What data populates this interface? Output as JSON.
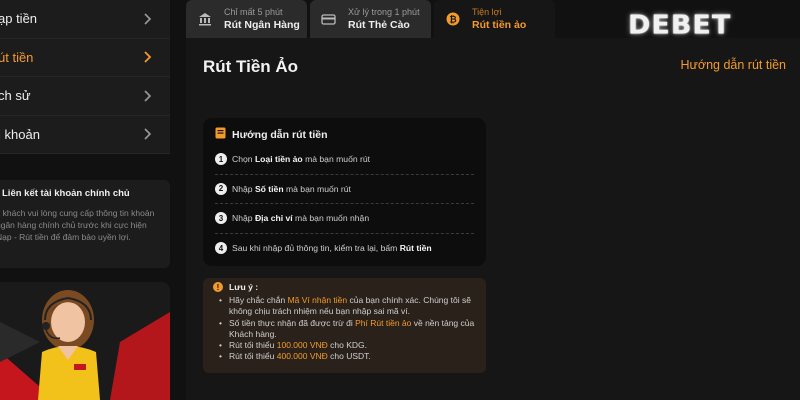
{
  "sidebar": {
    "items": [
      {
        "label": "ạp tiền",
        "active": false
      },
      {
        "label": "út tiền",
        "active": true
      },
      {
        "label": "ch sử",
        "active": false
      },
      {
        "label": "i khoản",
        "active": false
      }
    ],
    "info": {
      "title": "Liên kết tài khoản chính chủ",
      "text": "ý khách vui lòng cung cấp thông tin khoản ngân hàng chính chủ trước khi cực hiện Nạp - Rút tiền để đảm bảo uyền lợi."
    }
  },
  "tabs": [
    {
      "sub": "Chỉ mất 5 phút",
      "label": "Rút Ngân Hàng",
      "icon": "bank-icon",
      "active": false
    },
    {
      "sub": "Xử lý trong 1 phút",
      "label": "Rút Thẻ Cào",
      "icon": "card-icon",
      "active": false
    },
    {
      "sub": "Tiện lợi",
      "label": "Rút tiền ảo",
      "icon": "bitcoin-icon",
      "active": true
    }
  ],
  "logo": "DEBET",
  "main": {
    "title": "Rút Tiền Ảo",
    "guide_link": "Hướng dẫn rút tiền",
    "guide": {
      "heading": "Hướng dẫn rút tiền",
      "steps": [
        {
          "num": "1",
          "pre": "Chọn ",
          "bold": "Loại tiền ảo",
          "post": " mà bạn muốn rút"
        },
        {
          "num": "2",
          "pre": "Nhập ",
          "bold": "Số tiền",
          "post": " mà bạn muốn rút"
        },
        {
          "num": "3",
          "pre": "Nhập ",
          "bold": "Địa chỉ ví",
          "post": " mà bạn muốn nhận"
        },
        {
          "num": "4",
          "pre": "Sau khi nhập đủ thông tin, kiểm tra lại, bấm ",
          "bold": "Rút tiền",
          "post": ""
        }
      ]
    },
    "notes": {
      "heading": "Lưu ý :",
      "items": [
        {
          "pre": "Hãy chắc chắn ",
          "hl": "Mã Ví nhận tiền",
          "post": " của bạn chính xác. Chúng tôi sẽ không chịu trách nhiệm nếu bạn nhập sai mã ví."
        },
        {
          "pre": "Số tiền thực nhận đã được trừ đi ",
          "hl": "Phí Rút tiền ảo",
          "post": " về nền tảng của Khách hàng."
        },
        {
          "pre": "Rút tối thiểu ",
          "hl": "100.000 VNĐ",
          "post": " cho KDG."
        },
        {
          "pre": "Rút tối thiểu ",
          "hl": "400.000 VNĐ",
          "post": " cho USDT."
        }
      ]
    }
  },
  "colors": {
    "accent": "#f39a2d",
    "background": "#111111",
    "panel": "#161616"
  }
}
